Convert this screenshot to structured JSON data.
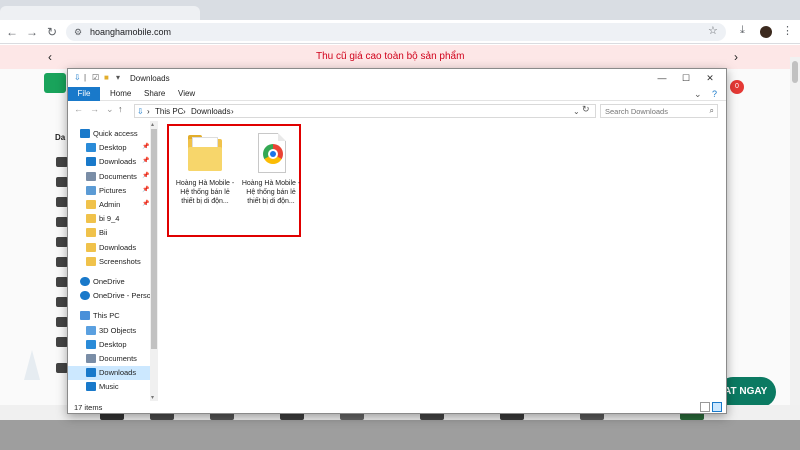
{
  "browser": {
    "url": "hoanghamobile.com",
    "back_icon": "arrow-left",
    "forward_icon": "arrow-right",
    "reload_icon": "reload",
    "bookmark_icon": "star",
    "download_icon": "download",
    "menu_icon": "kebab"
  },
  "site": {
    "promo_text": "Thu cũ giá cao toàn bộ sản phẩm",
    "cart_count": "0",
    "left_label": "Da",
    "cta_label": "AT NGAY",
    "colors": {
      "promo_bg": "#fde7e7",
      "promo_text": "#d0021b",
      "cta": "#0b7a62"
    }
  },
  "explorer": {
    "title": "Downloads",
    "ribbon_tabs": [
      "File",
      "Home",
      "Share",
      "View"
    ],
    "breadcrumb": [
      "This PC",
      "Downloads"
    ],
    "search_placeholder": "Search Downloads",
    "nav_items": [
      {
        "label": "Quick access",
        "icon": "star-icon",
        "pinned": false,
        "indent": 0
      },
      {
        "label": "Desktop",
        "icon": "desktop-icon",
        "pinned": true,
        "indent": 1
      },
      {
        "label": "Downloads",
        "icon": "download-icon",
        "pinned": true,
        "indent": 1
      },
      {
        "label": "Documents",
        "icon": "documents-icon",
        "pinned": true,
        "indent": 1
      },
      {
        "label": "Pictures",
        "icon": "pictures-icon",
        "pinned": true,
        "indent": 1
      },
      {
        "label": "Admin",
        "icon": "folder-icon",
        "pinned": true,
        "indent": 1
      },
      {
        "label": "bi 9_4",
        "icon": "folder-icon",
        "pinned": false,
        "indent": 1
      },
      {
        "label": "Bii",
        "icon": "folder-icon",
        "pinned": false,
        "indent": 1
      },
      {
        "label": "Downloads",
        "icon": "folder-icon",
        "pinned": false,
        "indent": 1
      },
      {
        "label": "Screenshots",
        "icon": "folder-icon",
        "pinned": false,
        "indent": 1
      },
      {
        "label": "OneDrive",
        "icon": "cloud-icon",
        "pinned": false,
        "indent": 0
      },
      {
        "label": "OneDrive - Person",
        "icon": "cloud-icon",
        "pinned": false,
        "indent": 0
      },
      {
        "label": "This PC",
        "icon": "pc-icon",
        "pinned": false,
        "indent": 0
      },
      {
        "label": "3D Objects",
        "icon": "cube-icon",
        "pinned": false,
        "indent": 1
      },
      {
        "label": "Desktop",
        "icon": "desktop-icon",
        "pinned": false,
        "indent": 1
      },
      {
        "label": "Documents",
        "icon": "documents-icon",
        "pinned": false,
        "indent": 1
      },
      {
        "label": "Downloads",
        "icon": "download-icon",
        "pinned": false,
        "indent": 1,
        "selected": true
      },
      {
        "label": "Music",
        "icon": "music-icon",
        "pinned": false,
        "indent": 1
      }
    ],
    "files": [
      {
        "name": "Hoàng Hà Mobile - Hệ thống bán lẻ thiết bị di độn...",
        "type": "folder"
      },
      {
        "name": "Hoàng Hà Mobile - Hệ thống bán lẻ thiết bị di độn...",
        "type": "chrome-html"
      }
    ],
    "status": {
      "item_count": "17 items"
    }
  }
}
